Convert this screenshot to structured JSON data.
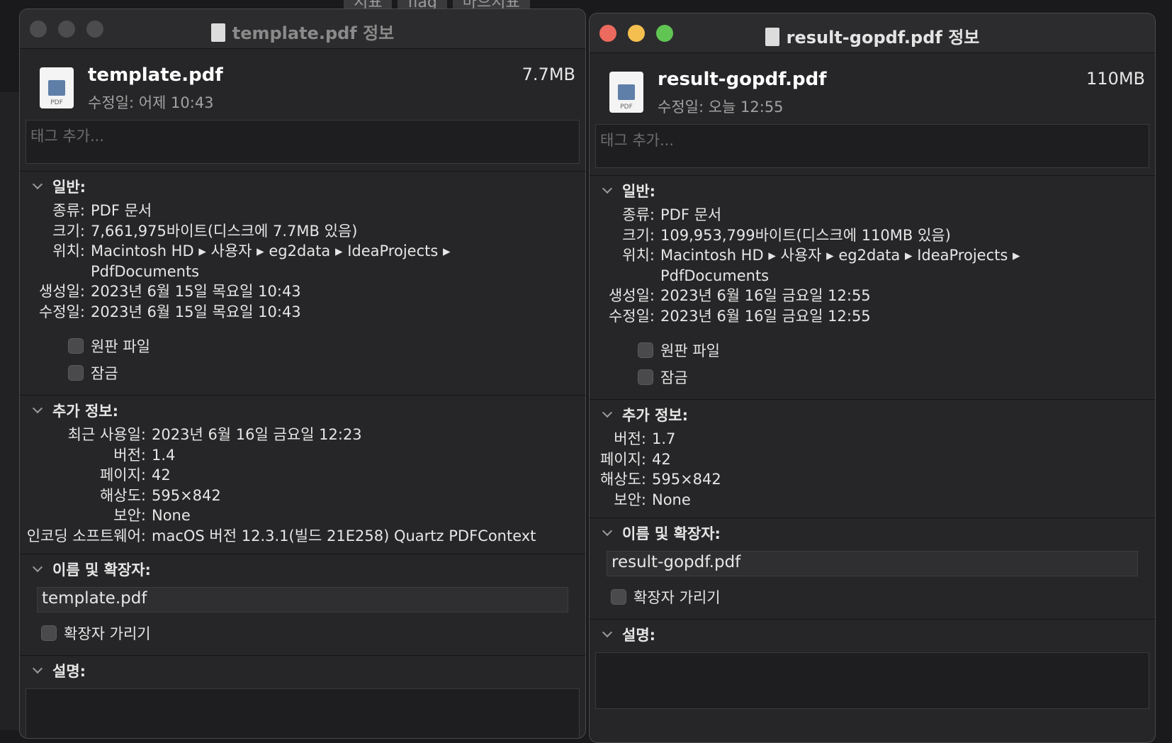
{
  "background": {
    "tabs": [
      "지표",
      "flag",
      "마으지표"
    ]
  },
  "left": {
    "title": "template.pdf 정보",
    "file_name": "template.pdf",
    "file_size": "7.7MB",
    "modified_line": "수정일: 어제 10:43",
    "tag_placeholder": "태그 추가...",
    "icon_label": "PDF",
    "general": {
      "label": "일반:",
      "rows": [
        {
          "k": "종류:",
          "v": "PDF 문서"
        },
        {
          "k": "크기:",
          "v": "7,661,975바이트(디스크에 7.7MB 있음)"
        },
        {
          "k": "위치:",
          "v": "Macintosh HD ▸ 사용자 ▸ eg2data ▸ IdeaProjects ▸"
        },
        {
          "k": "",
          "v": "PdfDocuments"
        },
        {
          "k": "생성일:",
          "v": "2023년 6월 15일 목요일 10:43"
        },
        {
          "k": "수정일:",
          "v": "2023년 6월 15일 목요일 10:43"
        }
      ],
      "stationery": "원판 파일",
      "locked": "잠금"
    },
    "more_info": {
      "label": "추가 정보:",
      "rows": [
        {
          "k": "최근 사용일:",
          "v": "2023년 6월 16일 금요일 12:23"
        },
        {
          "k": "버전:",
          "v": "1.4"
        },
        {
          "k": "페이지:",
          "v": "42"
        },
        {
          "k": "해상도:",
          "v": "595×842"
        },
        {
          "k": "보안:",
          "v": "None"
        },
        {
          "k": "인코딩 소프트웨어:",
          "v": "macOS 버전 12.3.1(빌드 21E258) Quartz PDFContext"
        }
      ]
    },
    "name_ext": {
      "label": "이름 및 확장자:",
      "value": "template.pdf",
      "hide_ext": "확장자 가리기"
    },
    "comments": {
      "label": "설명:"
    }
  },
  "right": {
    "title": "result-gopdf.pdf 정보",
    "file_name": "result-gopdf.pdf",
    "file_size": "110MB",
    "modified_line": "수정일: 오늘 12:55",
    "tag_placeholder": "태그 추가...",
    "icon_label": "PDF",
    "general": {
      "label": "일반:",
      "rows": [
        {
          "k": "종류:",
          "v": "PDF 문서"
        },
        {
          "k": "크기:",
          "v": "109,953,799바이트(디스크에 110MB 있음)"
        },
        {
          "k": "위치:",
          "v": "Macintosh HD ▸ 사용자 ▸ eg2data ▸ IdeaProjects ▸"
        },
        {
          "k": "",
          "v": "PdfDocuments"
        },
        {
          "k": "생성일:",
          "v": "2023년 6월 16일 금요일 12:55"
        },
        {
          "k": "수정일:",
          "v": "2023년 6월 16일 금요일 12:55"
        }
      ],
      "stationery": "원판 파일",
      "locked": "잠금"
    },
    "more_info": {
      "label": "추가 정보:",
      "rows": [
        {
          "k": "버전:",
          "v": "1.7"
        },
        {
          "k": "페이지:",
          "v": "42"
        },
        {
          "k": "해상도:",
          "v": "595×842"
        },
        {
          "k": "보안:",
          "v": "None"
        }
      ]
    },
    "name_ext": {
      "label": "이름 및 확장자:",
      "value": "result-gopdf.pdf",
      "hide_ext": "확장자 가리기"
    },
    "comments": {
      "label": "설명:"
    }
  }
}
